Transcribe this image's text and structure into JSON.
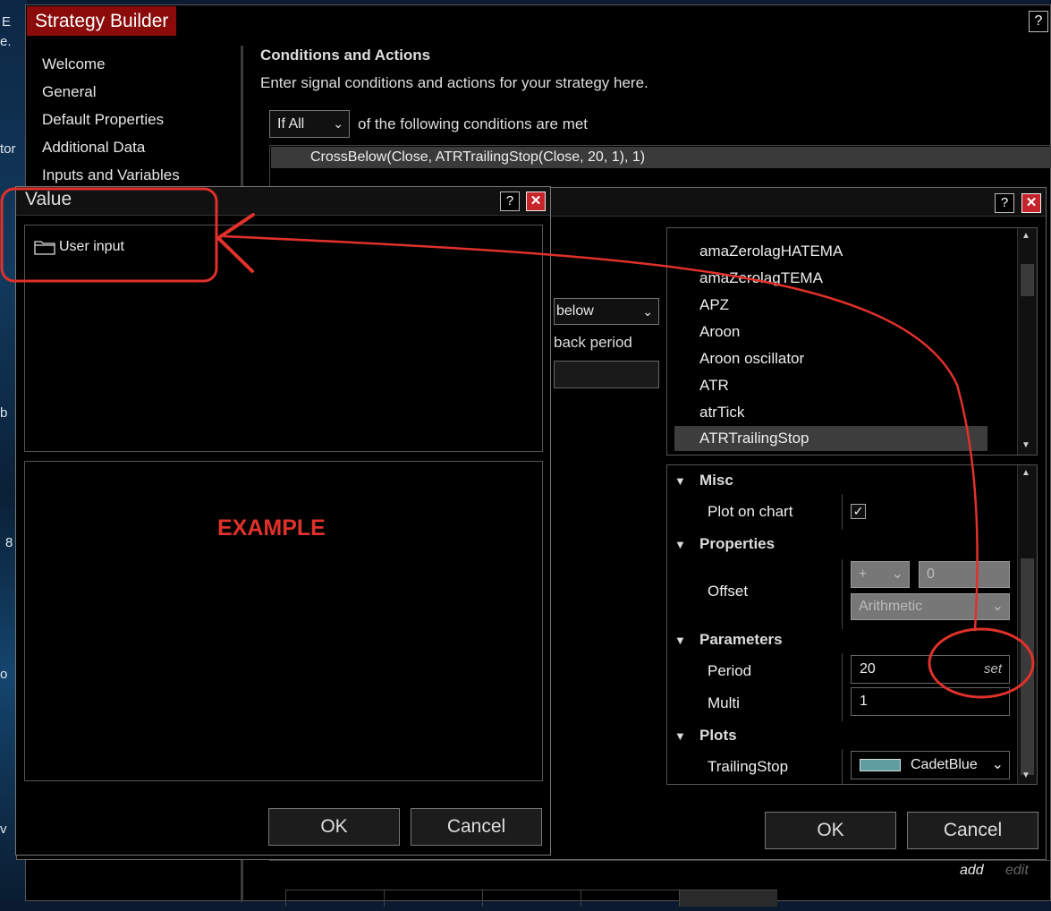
{
  "desktop": {
    "fragments": [
      "E",
      "e.",
      "tor",
      "b",
      "8",
      "o",
      "v"
    ]
  },
  "main_window": {
    "title": "Strategy Builder",
    "help": "?",
    "nav_items": [
      "Welcome",
      "General",
      "Default Properties",
      "Additional Data",
      "Inputs and Variables"
    ],
    "section_title": "Conditions and Actions",
    "section_desc": "Enter signal conditions and actions for your strategy here.",
    "condition_mode": "If All",
    "condition_text": "of the following conditions are met",
    "condition_row": "CrossBelow(Close, ATRTrailingStop(Close, 20, 1), 1)",
    "add_label": "add",
    "edit_label": "edit"
  },
  "indicator_dialog": {
    "help": "?",
    "close": "✕",
    "partial_select_value": "below",
    "partial_label": "back period",
    "indicators": [
      "amaZerolagHATEMA",
      "amaZerolagTEMA",
      "APZ",
      "Aroon",
      "Aroon oscillator",
      "ATR",
      "atrTick",
      "ATRTrailingStop"
    ],
    "selected_indicator": "ATRTrailingStop",
    "props": {
      "misc": "Misc",
      "plot_on_chart": "Plot on chart",
      "plot_on_chart_checked": "✓",
      "properties": "Properties",
      "offset": "Offset",
      "offset_sign": "+",
      "offset_value": "0",
      "offset_type": "Arithmetic",
      "parameters": "Parameters",
      "period": "Period",
      "period_value": "20",
      "set_label": "set",
      "multi": "Multi",
      "multi_value": "1",
      "plots": "Plots",
      "trailing_stop": "TrailingStop",
      "trailing_stop_color_name": "CadetBlue",
      "trailing_stop_color": "#5f9ea0"
    },
    "ok": "OK",
    "cancel": "Cancel"
  },
  "value_dialog": {
    "title": "Value",
    "help": "?",
    "close": "✕",
    "tree_item": "User input",
    "example_label": "EXAMPLE",
    "ok": "OK",
    "cancel": "Cancel"
  },
  "colors": {
    "accent_title": "#8b0b0b",
    "annotation": "#e0312a",
    "close_button": "#c4242a"
  }
}
